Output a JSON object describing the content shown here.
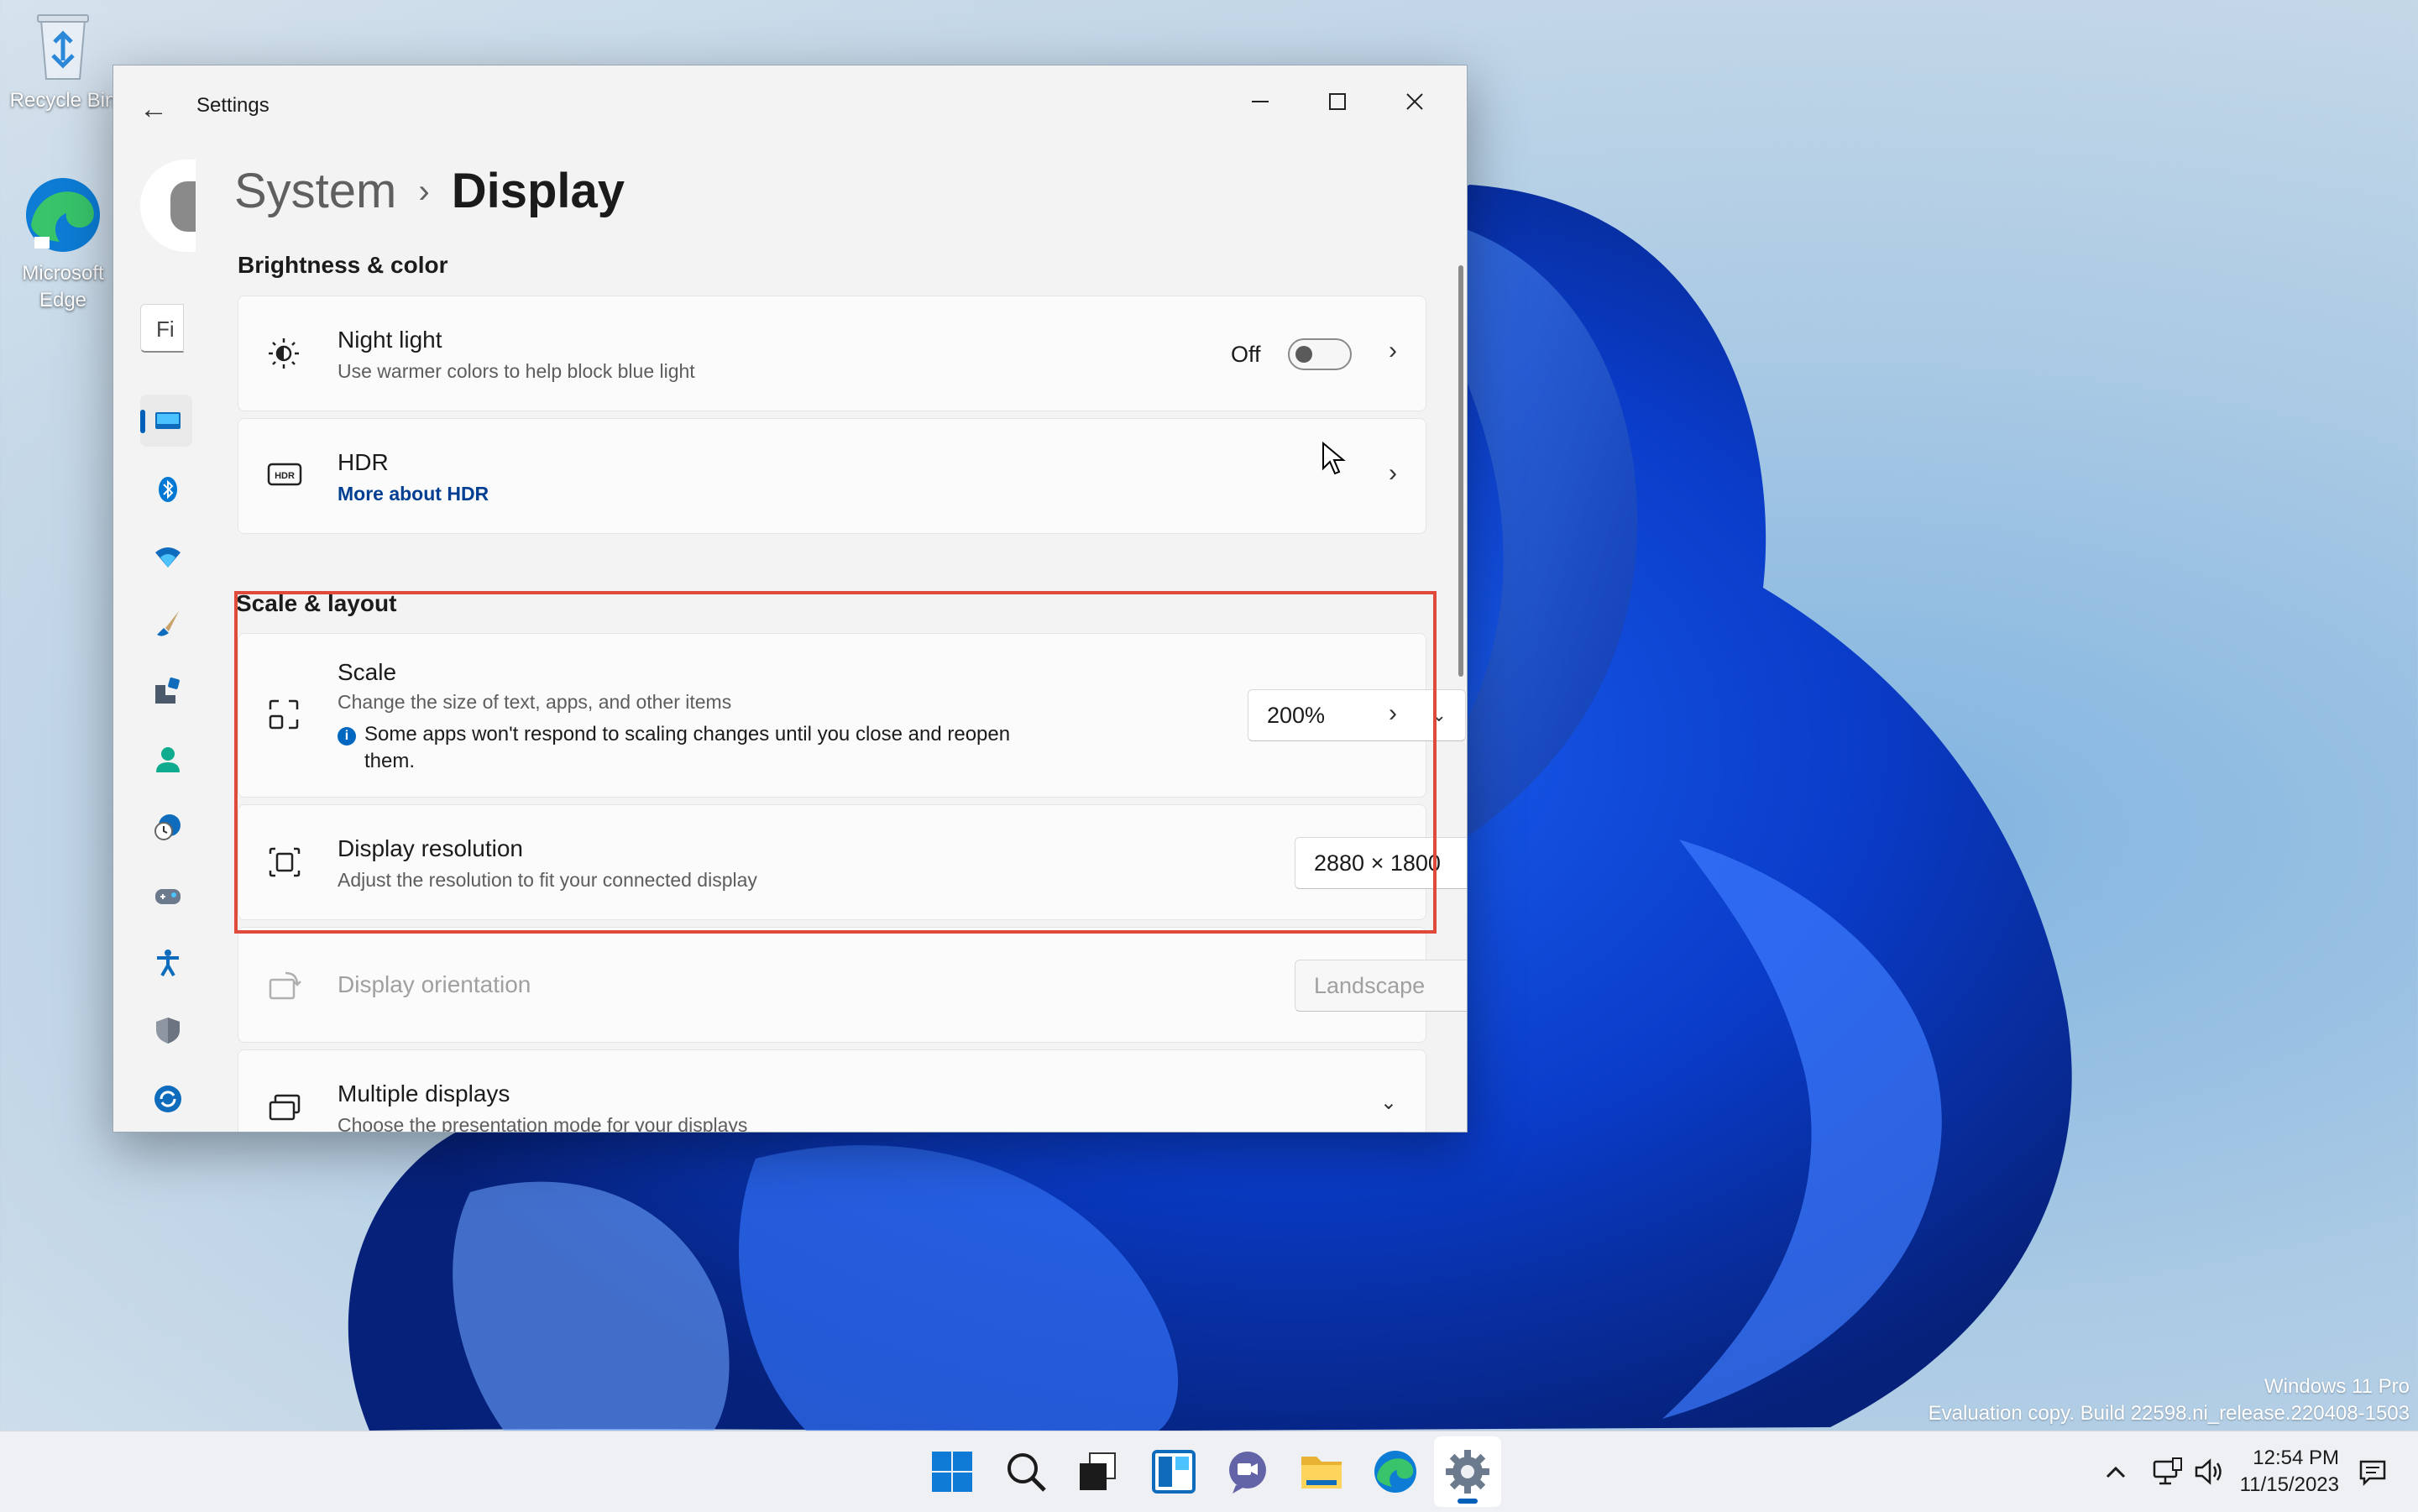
{
  "desktop": {
    "icons": [
      {
        "label": "Recycle Bin"
      },
      {
        "label": "Microsoft Edge"
      }
    ],
    "watermark": {
      "line1": "Windows 11 Pro",
      "line2": "Evaluation copy. Build 22598.ni_release.220408-1503"
    }
  },
  "window": {
    "title": "Settings",
    "back_icon": "back-arrow-icon",
    "controls": [
      "minimize",
      "maximize",
      "close"
    ],
    "search_placeholder": "Fi"
  },
  "nav": {
    "items": [
      {
        "name": "system",
        "icon": "monitor-icon",
        "selected": true
      },
      {
        "name": "bluetooth",
        "icon": "bluetooth-icon"
      },
      {
        "name": "network",
        "icon": "wifi-icon"
      },
      {
        "name": "personalization",
        "icon": "brush-icon"
      },
      {
        "name": "apps",
        "icon": "apps-icon"
      },
      {
        "name": "accounts",
        "icon": "person-icon"
      },
      {
        "name": "time-language",
        "icon": "clock-globe-icon"
      },
      {
        "name": "gaming",
        "icon": "gamepad-icon"
      },
      {
        "name": "accessibility",
        "icon": "accessibility-icon"
      },
      {
        "name": "privacy",
        "icon": "shield-icon"
      },
      {
        "name": "windows-update",
        "icon": "update-icon"
      }
    ]
  },
  "breadcrumb": {
    "parent": "System",
    "separator": "›",
    "current": "Display"
  },
  "sections": {
    "brightness": "Brightness & color",
    "scale": "Scale & layout"
  },
  "night_light": {
    "title": "Night light",
    "subtitle": "Use warmer colors to help block blue light",
    "state_label": "Off",
    "on": false
  },
  "hdr": {
    "title": "HDR",
    "link": "More about HDR"
  },
  "scale": {
    "title": "Scale",
    "subtitle": "Change the size of text, apps, and other items",
    "note": "Some apps won't respond to scaling changes until you close and reopen them.",
    "value": "200%"
  },
  "resolution": {
    "title": "Display resolution",
    "subtitle": "Adjust the resolution to fit your connected display",
    "value": "2880 × 1800"
  },
  "orientation": {
    "title": "Display orientation",
    "value": "Landscape",
    "disabled": true
  },
  "multiple": {
    "title": "Multiple displays",
    "subtitle": "Choose the presentation mode for your displays"
  },
  "taskbar": {
    "apps": [
      "start-icon",
      "search-icon",
      "task-view-icon",
      "widgets-icon",
      "chat-icon",
      "file-explorer-icon",
      "edge-icon",
      "settings-icon"
    ],
    "active": "settings-icon",
    "tray": [
      "chevron-up-icon",
      "network-icon",
      "volume-icon"
    ],
    "time": "12:54 PM",
    "date": "11/15/2023"
  },
  "colors": {
    "accent": "#005fb8",
    "highlight_box": "#e04a3a",
    "link": "#003e92"
  }
}
